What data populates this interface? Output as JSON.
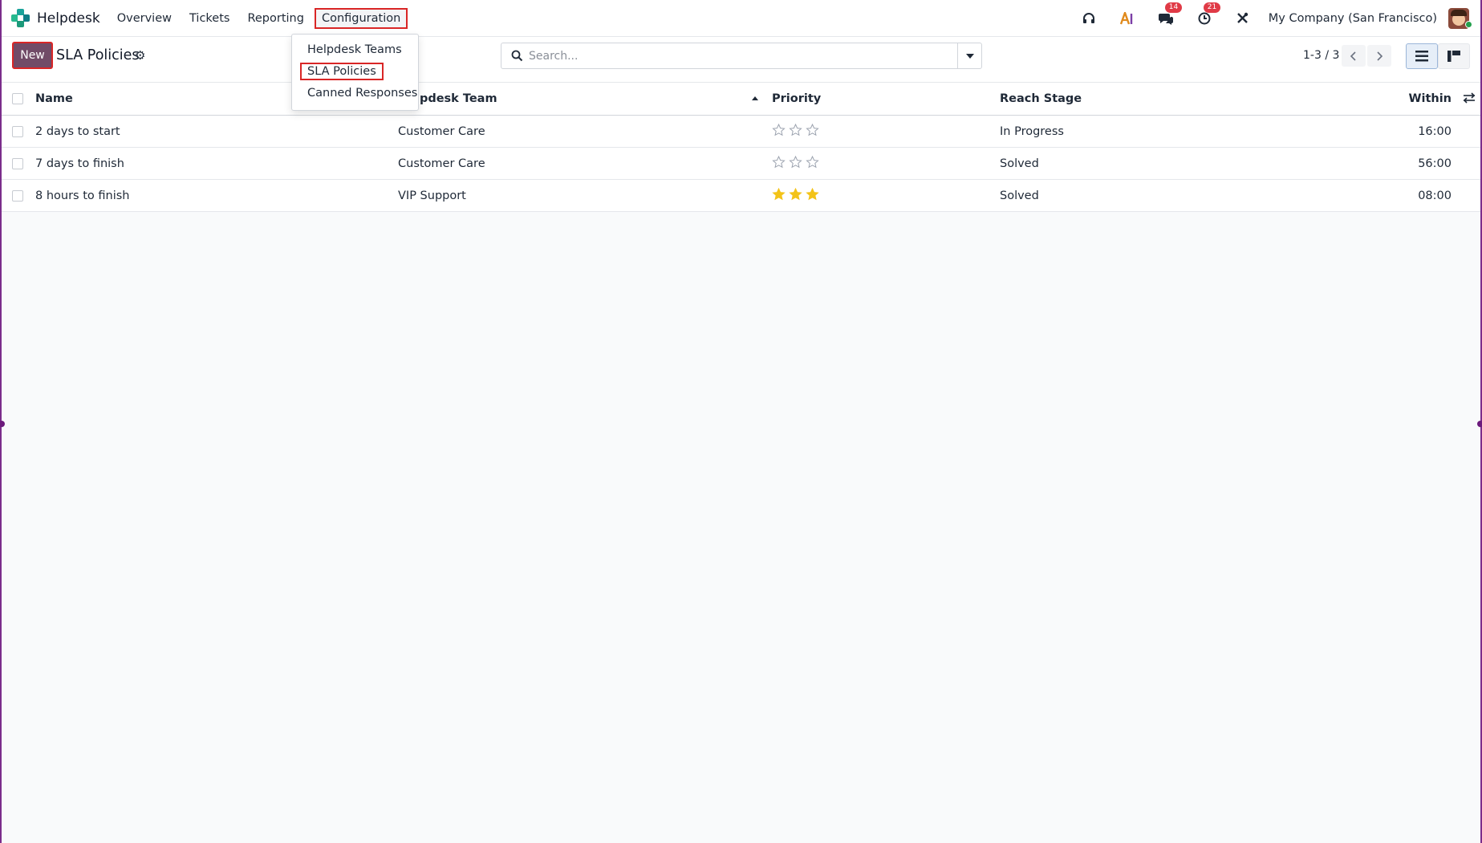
{
  "app": {
    "name": "Helpdesk",
    "menu": [
      "Overview",
      "Tickets",
      "Reporting",
      "Configuration"
    ],
    "active_menu": "Configuration"
  },
  "systray": {
    "messages_count": "14",
    "activities_count": "21",
    "company": "My Company (San Francisco)"
  },
  "dropdown": {
    "items": [
      "Helpdesk Teams",
      "SLA Policies",
      "Canned Responses"
    ],
    "active": "SLA Policies"
  },
  "control_panel": {
    "new_label": "New",
    "title": "SLA Policies",
    "search_placeholder": "Search...",
    "pager": "1-3 / 3"
  },
  "table": {
    "columns": [
      "Name",
      "Helpdesk Team",
      "Priority",
      "Reach Stage",
      "Within"
    ],
    "rows": [
      {
        "name": "2 days to start",
        "team": "Customer Care",
        "priority_stars": 0,
        "stage": "In Progress",
        "within": "16:00"
      },
      {
        "name": "7 days to finish",
        "team": "Customer Care",
        "priority_stars": 0,
        "stage": "Solved",
        "within": "56:00"
      },
      {
        "name": "8 hours to finish",
        "team": "VIP Support",
        "priority_stars": 3,
        "stage": "Solved",
        "within": "08:00"
      }
    ]
  },
  "colors": {
    "primary": "#714b67",
    "highlight": "#d92626",
    "star": "#f3c318"
  }
}
